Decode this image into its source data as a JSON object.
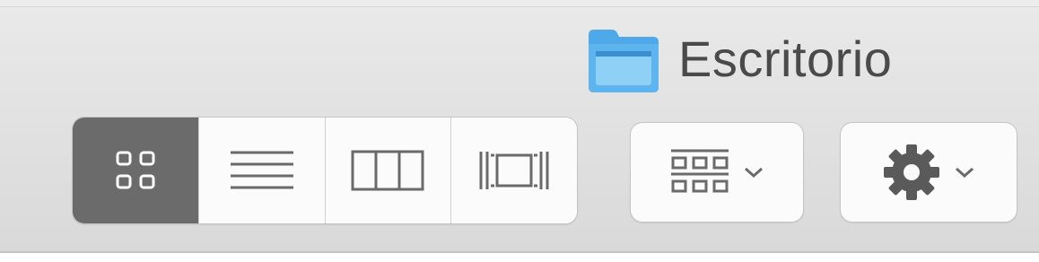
{
  "window": {
    "title": "Escritorio",
    "title_icon": "folder-icon"
  },
  "view_modes": {
    "selected": "icon-view",
    "items": [
      {
        "name": "icon-view",
        "icon": "grid-icon"
      },
      {
        "name": "list-view",
        "icon": "list-icon"
      },
      {
        "name": "column-view",
        "icon": "columns-icon"
      },
      {
        "name": "cover-flow-view",
        "icon": "cover-flow-icon"
      }
    ]
  },
  "arrange_menu": {
    "icon": "arrange-grid-icon",
    "indicator": "chevron-down-icon"
  },
  "action_menu": {
    "icon": "gear-icon",
    "indicator": "chevron-down-icon"
  },
  "colors": {
    "toolbar_bg": "#e0e0e0",
    "selected_segment": "#6b6b6b",
    "folder_blue": "#4fa9e8",
    "icon_dark": "#5a5a5a"
  }
}
